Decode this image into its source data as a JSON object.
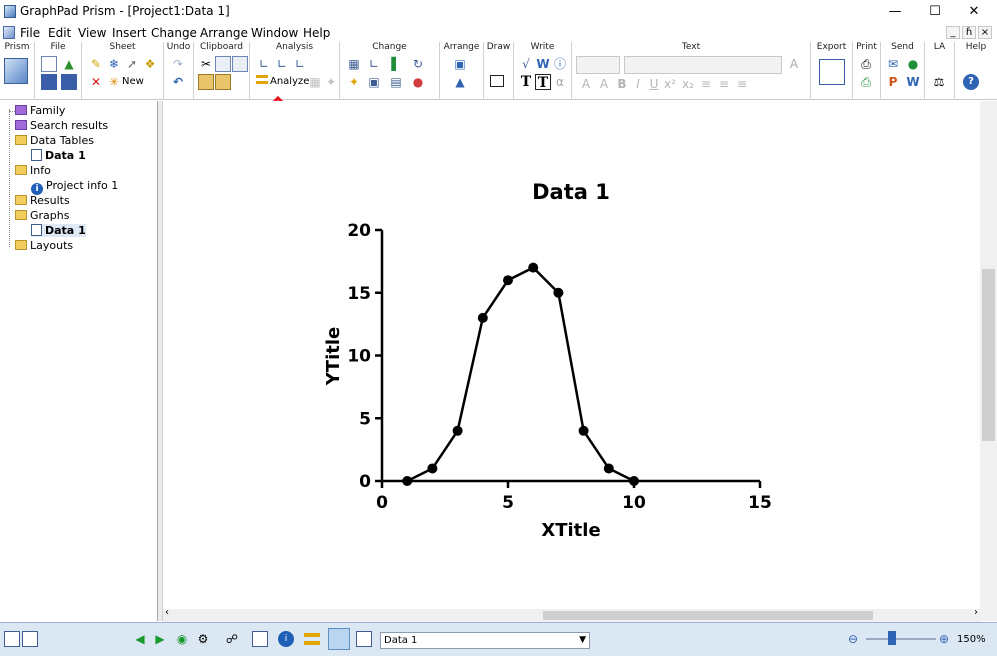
{
  "window": {
    "title": "GraphPad Prism - [Project1:Data 1]",
    "minimize": "—",
    "maximize": "☐",
    "close": "✕"
  },
  "menu": [
    "File",
    "Edit",
    "View",
    "Insert",
    "Change",
    "Arrange",
    "Window",
    "Help"
  ],
  "mdi_controls": [
    "_",
    "ɦ",
    "×"
  ],
  "ribbon": {
    "groups": [
      "Prism",
      "File",
      "Sheet",
      "Undo",
      "Clipboard",
      "Analysis",
      "Change",
      "Arrange",
      "Draw",
      "Write",
      "Text",
      "Export",
      "Print",
      "Send",
      "LA",
      "Help"
    ],
    "new_label": "New",
    "analyze_label": "Analyze"
  },
  "navigator": {
    "items": [
      {
        "label": "Family",
        "type": "folder-purple"
      },
      {
        "label": "Search results",
        "type": "folder-purple"
      },
      {
        "label": "Data Tables",
        "type": "folder"
      },
      {
        "label": "Data 1",
        "type": "sheet",
        "bold": true
      },
      {
        "label": "Info",
        "type": "folder"
      },
      {
        "label": "Project info 1",
        "type": "info"
      },
      {
        "label": "Results",
        "type": "folder"
      },
      {
        "label": "Graphs",
        "type": "folder"
      },
      {
        "label": "Data 1",
        "type": "graph",
        "bold": true
      },
      {
        "label": "Layouts",
        "type": "folder"
      }
    ]
  },
  "statusbar": {
    "sheet_select": "Data 1",
    "zoom": "150%",
    "zoom_level": 0.5
  },
  "chart_data": {
    "type": "line",
    "title": "Data 1",
    "xlabel": "XTitle",
    "ylabel": "YTitle",
    "xlim": [
      0,
      15
    ],
    "ylim": [
      0,
      20
    ],
    "xticks": [
      0,
      5,
      10,
      15
    ],
    "yticks": [
      0,
      5,
      10,
      15,
      20
    ],
    "x": [
      1,
      2,
      3,
      4,
      5,
      6,
      7,
      8,
      9,
      10
    ],
    "series": [
      {
        "values": [
          0,
          1,
          4,
          13,
          16,
          17,
          15,
          4,
          1,
          0
        ]
      }
    ],
    "grid": false,
    "marker": "circle",
    "line_color": "#000000"
  },
  "annotation": {
    "color": "#e8101a",
    "target": "Analyze"
  }
}
